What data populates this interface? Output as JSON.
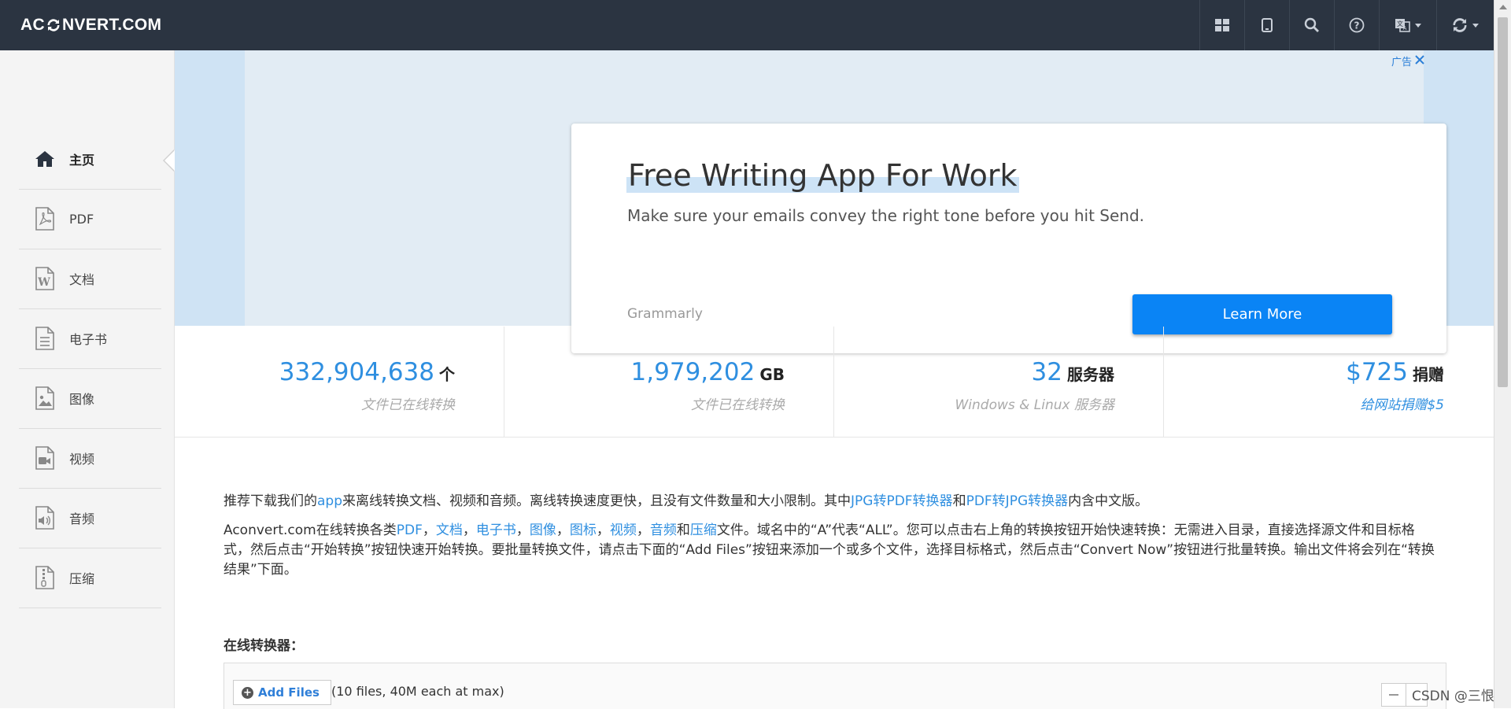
{
  "header": {
    "logo_left": "AC",
    "logo_right": "NVERT.COM",
    "nav": [
      {
        "icon": "grid-icon"
      },
      {
        "icon": "tablet-icon"
      },
      {
        "icon": "search-icon"
      },
      {
        "icon": "help-icon"
      },
      {
        "icon": "language-icon"
      },
      {
        "icon": "refresh-icon"
      }
    ]
  },
  "sidebar": {
    "items": [
      {
        "label": "主页",
        "icon": "home-icon"
      },
      {
        "label": "PDF",
        "icon": "pdf-icon"
      },
      {
        "label": "文档",
        "icon": "word-icon"
      },
      {
        "label": "电子书",
        "icon": "ebook-icon"
      },
      {
        "label": "图像",
        "icon": "image-icon"
      },
      {
        "label": "视频",
        "icon": "video-icon"
      },
      {
        "label": "音频",
        "icon": "audio-icon"
      },
      {
        "label": "压缩",
        "icon": "archive-icon"
      }
    ]
  },
  "ad": {
    "badge": "广告",
    "title": "Free Writing App For Work",
    "subtitle": "Make sure your emails convey the right tone before you hit Send.",
    "brand": "Grammarly",
    "button": "Learn More"
  },
  "stats": [
    {
      "value": "332,904,638",
      "unit": "个",
      "desc": "文件已在线转换"
    },
    {
      "value": "1,979,202",
      "unit": "GB",
      "desc": "文件已在线转换"
    },
    {
      "value": "32",
      "unit": "服务器",
      "desc": "Windows & Linux 服务器"
    },
    {
      "value": "$725",
      "unit": "捐赠",
      "desc": "给网站捐赠$5"
    }
  ],
  "content": {
    "p1": {
      "a": "推荐下载我们的",
      "link_app": "app",
      "b": "来离线转换文档、视频和音频。离线转换速度更快，且没有文件数量和大小限制。其中",
      "link_jpg2pdf": "JPG转PDF转换器",
      "c": "和",
      "link_pdf2jpg": "PDF转JPG转换器",
      "d": "内含中文版。"
    },
    "p2": {
      "a": "Aconvert.com在线转换各类",
      "links": [
        "PDF",
        "文档",
        "电子书",
        "图像",
        "图标",
        "视频",
        "音频",
        "压缩"
      ],
      "sep": "，",
      "and": "和",
      "b": "文件。域名中的“A”代表“ALL”。您可以点击右上角的转换按钮开始快速转换：无需进入目录，直接选择源文件和目标格式，然后点击“开始转换”按钮快速开始转换。要批量转换文件，请点击下面的“Add Files”按钮来添加一个或多个文件，选择目标格式，然后点击“Convert Now”按钮进行批量转换。输出文件将会列在“转换结果”下面。"
    },
    "section_title": "在线转换器：",
    "add_files": "Add Files",
    "add_hint": "(10 files, 40M each at max)"
  },
  "watermark": "CSDN @三恨"
}
